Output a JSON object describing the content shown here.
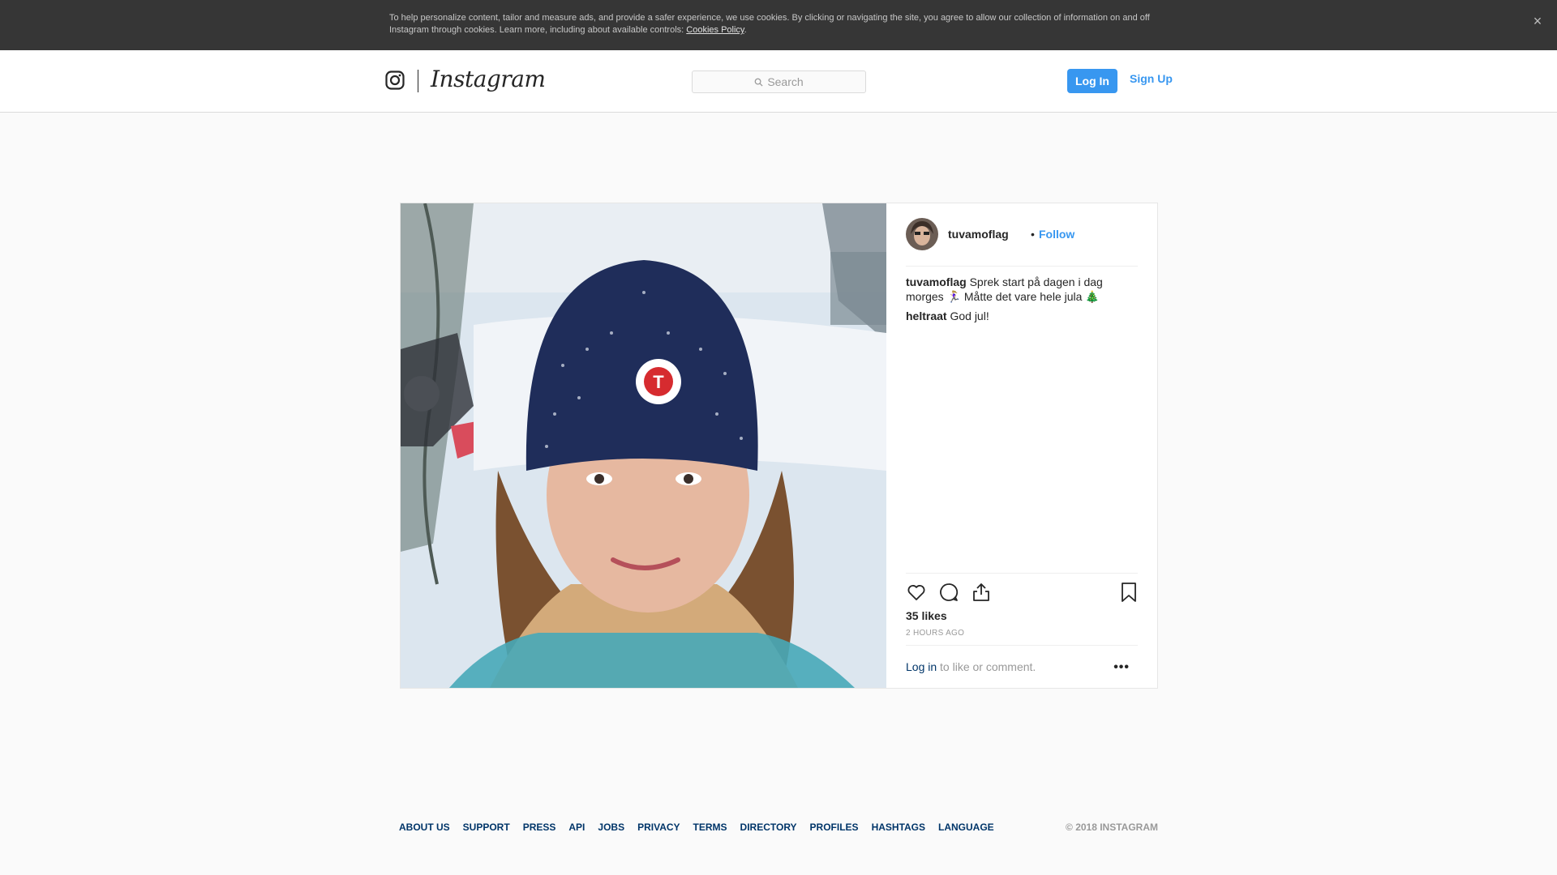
{
  "cookie_banner": {
    "text": "To help personalize content, tailor and measure ads, and provide a safer experience, we use cookies. By clicking or navigating the site, you agree to allow our collection of information on and off Instagram through cookies. Learn more, including about available controls: ",
    "link": "Cookies Policy",
    "close": "×"
  },
  "header": {
    "wordmark": "Instagram",
    "search_placeholder": "Search",
    "login": "Log In",
    "signup": "Sign Up"
  },
  "post": {
    "username": "tuvamoflag",
    "dot": "•",
    "follow": "Follow",
    "comments": [
      {
        "user": "tuvamoflag",
        "text": "Sprek start på dagen i dag morges 🏃🏼‍♀️ Måtte det vare hele jula 🎄"
      },
      {
        "user": "heltraat",
        "text": "God jul!"
      }
    ],
    "likes": "35 likes",
    "time": "2 HOURS AGO",
    "login_link": "Log in",
    "login_suffix": " to like or comment.",
    "more": "•••"
  },
  "footer": {
    "links": [
      "ABOUT US",
      "SUPPORT",
      "PRESS",
      "API",
      "JOBS",
      "PRIVACY",
      "TERMS",
      "DIRECTORY",
      "PROFILES",
      "HASHTAGS",
      "LANGUAGE"
    ],
    "copyright": "© 2018 INSTAGRAM"
  },
  "colors": {
    "accent": "#3897f0",
    "link": "#003569",
    "banner": "#363636"
  }
}
